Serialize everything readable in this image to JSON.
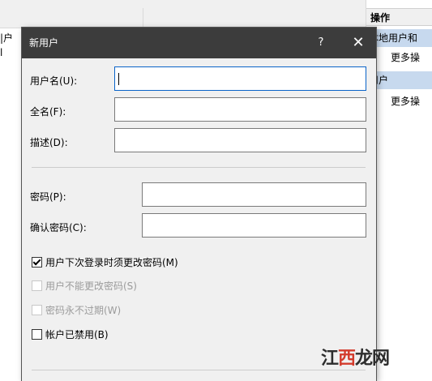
{
  "background": {
    "left_texts": [
      "|户",
      "l"
    ],
    "actions_panel": {
      "header": "操作",
      "group1": "本地用户和",
      "more1": "更多操",
      "group2": "用户",
      "more2": "更多操"
    }
  },
  "dialog": {
    "title": "新用户",
    "help_label": "?",
    "close_label": "✕",
    "fields": {
      "username": {
        "label": "用户名(U):",
        "value": ""
      },
      "fullname": {
        "label": "全名(F):",
        "value": ""
      },
      "description": {
        "label": "描述(D):",
        "value": ""
      },
      "password": {
        "label": "密码(P):",
        "value": ""
      },
      "confirm_password": {
        "label": "确认密码(C):",
        "value": ""
      }
    },
    "checkboxes": [
      {
        "label": "用户下次登录时须更改密码(M)",
        "checked": true,
        "enabled": true
      },
      {
        "label": "用户不能更改密码(S)",
        "checked": false,
        "enabled": false
      },
      {
        "label": "密码永不过期(W)",
        "checked": false,
        "enabled": false
      },
      {
        "label": "帐户已禁用(B)",
        "checked": false,
        "enabled": true
      }
    ]
  },
  "watermark": {
    "part1": "江",
    "part2": "西",
    "part3": "龙网"
  }
}
